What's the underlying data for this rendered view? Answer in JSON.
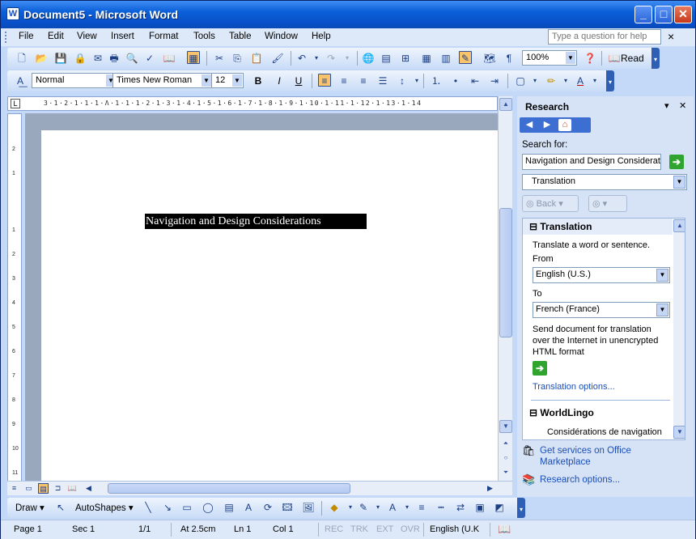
{
  "window": {
    "title": "Document5 - Microsoft Word",
    "app_icon": "word-icon",
    "buttons": {
      "minimize": "_",
      "maximize": "□",
      "close": "✕"
    }
  },
  "menubar": {
    "items": [
      "File",
      "Edit",
      "View",
      "Insert",
      "Format",
      "Tools",
      "Table",
      "Window",
      "Help"
    ],
    "help_placeholder": "Type a question for help"
  },
  "standard_toolbar": {
    "zoom": "100%",
    "read_label": "Read"
  },
  "formatting_toolbar": {
    "style": "Normal",
    "font": "Times New Roman",
    "size": "12",
    "bold": "B",
    "italic": "I",
    "underline": "U"
  },
  "ruler": {
    "text": "3·1·2·1·1·1·Λ·1·1·1·2·1·3·1·4·1·5·1·6·1·7·1·8·1·9·1·10·1·11·1·12·1·13·1·14"
  },
  "document": {
    "selected_text": "Navigation and Design Considerations"
  },
  "research": {
    "title": "Research",
    "search_for_label": "Search for:",
    "search_value": "Navigation and Design Considerations",
    "service": "Translation",
    "back_label": "Back",
    "translation_section": "Translation",
    "translate_hint": "Translate a word or sentence.",
    "from_label": "From",
    "from_value": "English (U.S.)",
    "to_label": "To",
    "to_value": "French (France)",
    "send_document_text": "Send document for translation over the Internet in unencrypted HTML format",
    "translation_options": "Translation options...",
    "worldlingo_section": "WorldLingo",
    "worldlingo_result": "Considérations de navigation",
    "get_services": "Get services on Office Marketplace",
    "research_options": "Research options..."
  },
  "draw_toolbar": {
    "draw_label": "Draw",
    "autoshapes_label": "AutoShapes"
  },
  "statusbar": {
    "page": "Page 1",
    "sec": "Sec 1",
    "pages": "1/1",
    "at": "At 2.5cm",
    "ln": "Ln 1",
    "col": "Col 1",
    "rec": "REC",
    "trk": "TRK",
    "ext": "EXT",
    "ovr": "OVR",
    "language": "English (U.K"
  }
}
